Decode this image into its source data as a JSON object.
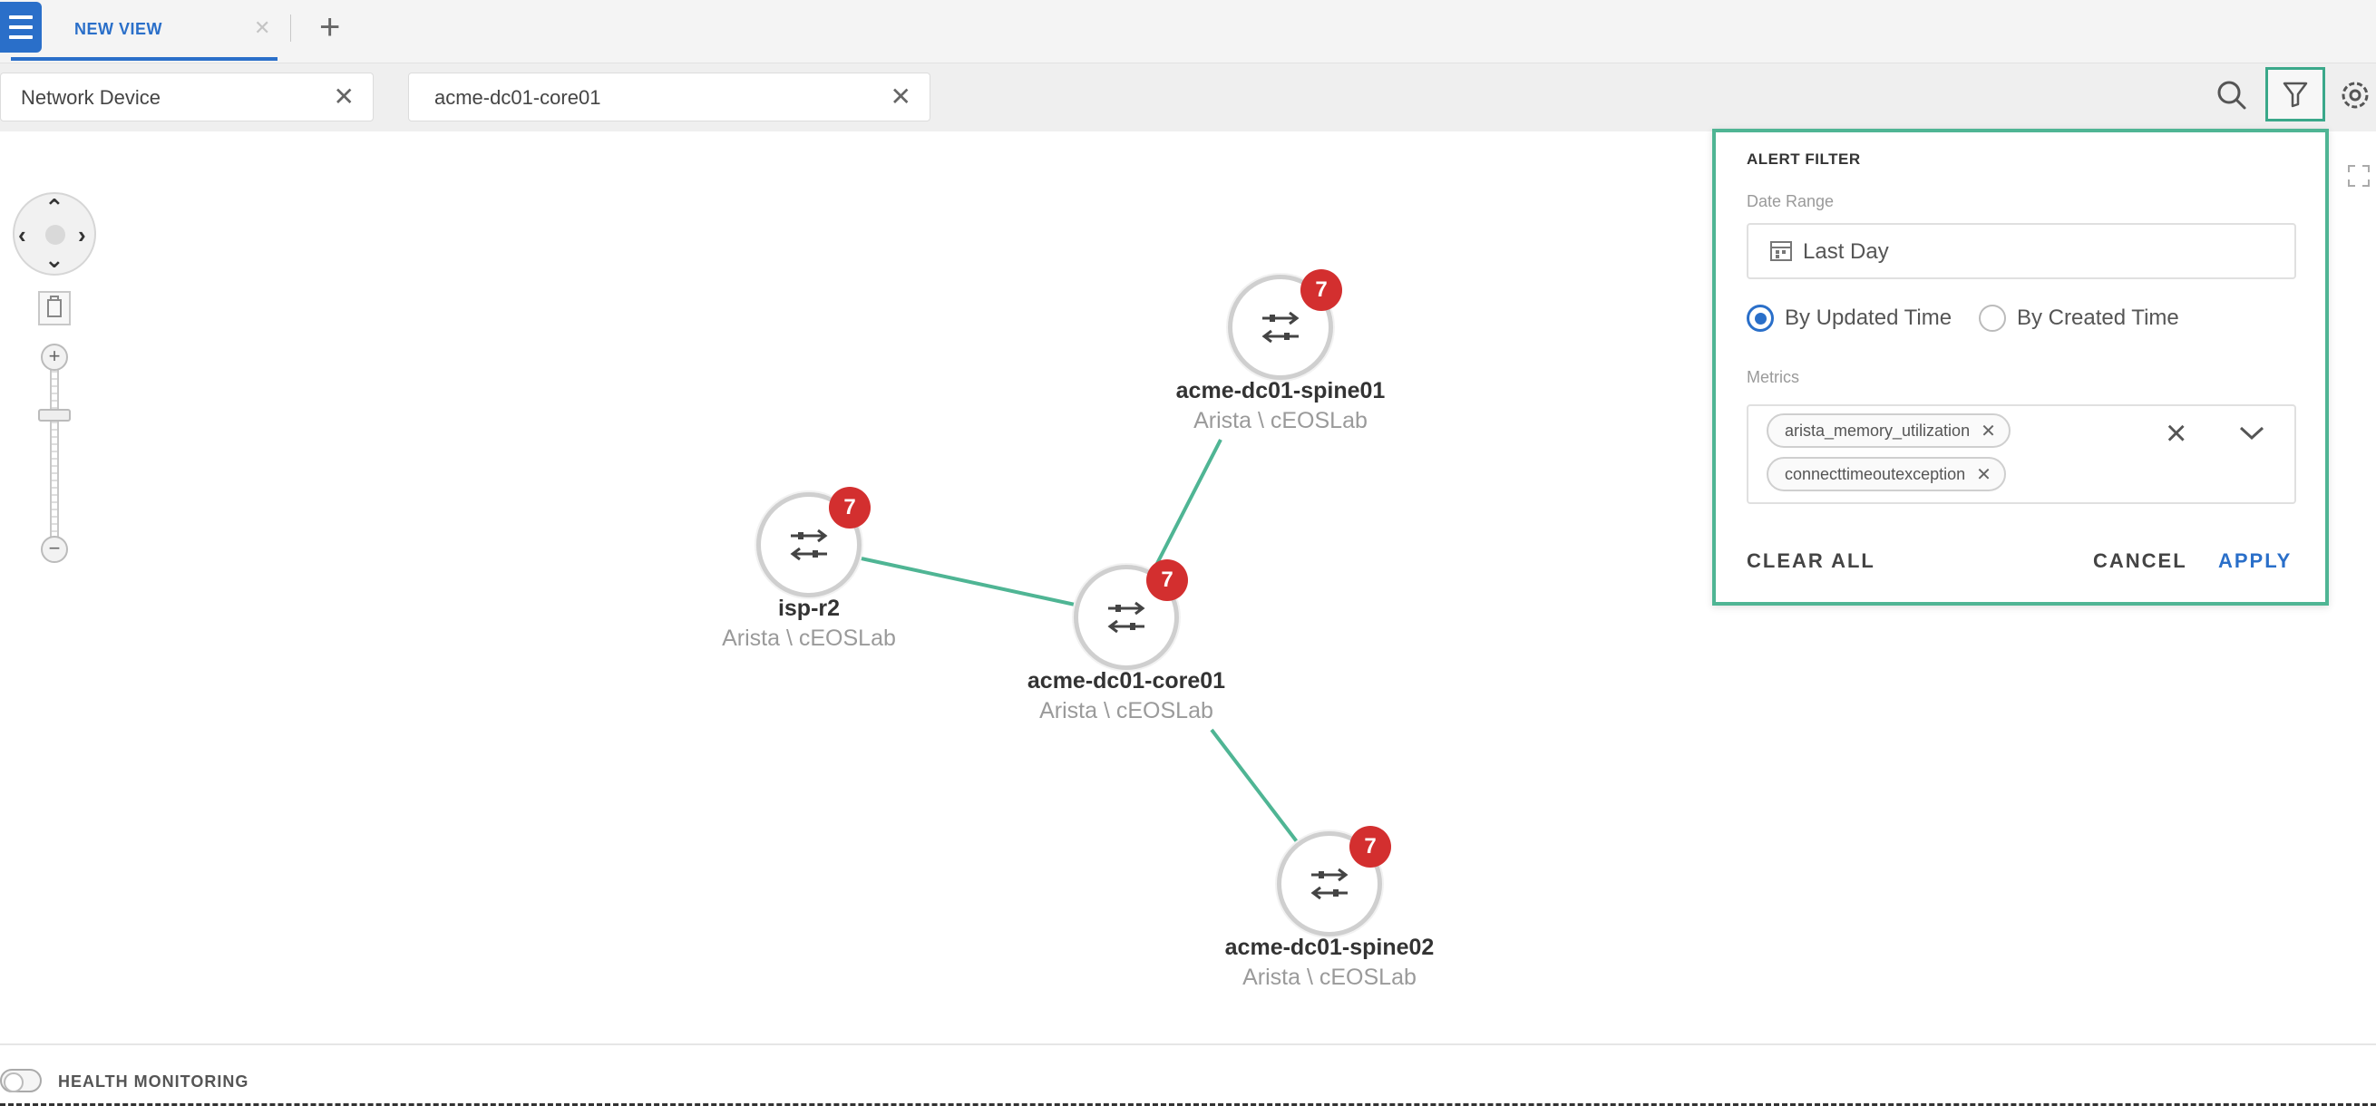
{
  "tabs": {
    "active_label": "NEW VIEW"
  },
  "filter_bar": {
    "chip1_text": "Network Device",
    "chip2_text": "acme-dc01-core01"
  },
  "nodes": {
    "spine01": {
      "name": "acme-dc01-spine01",
      "vendor": "Arista \\ cEOSLab",
      "alerts": "7"
    },
    "isp": {
      "name": "isp-r2",
      "vendor": "Arista \\ cEOSLab",
      "alerts": "7"
    },
    "core": {
      "name": "acme-dc01-core01",
      "vendor": "Arista \\ cEOSLab",
      "alerts": "7"
    },
    "spine02": {
      "name": "acme-dc01-spine02",
      "vendor": "Arista \\ cEOSLab",
      "alerts": "7"
    }
  },
  "alert_filter": {
    "title": "ALERT FILTER",
    "date_range_label": "Date Range",
    "date_range_value": "Last Day",
    "radio_updated": "By Updated Time",
    "radio_created": "By Created Time",
    "selected_radio": "By Updated Time",
    "metrics_label": "Metrics",
    "metrics": [
      "arista_memory_utilization",
      "connecttimeoutexception"
    ],
    "clear_all": "CLEAR ALL",
    "cancel": "CANCEL",
    "apply": "APPLY"
  },
  "bottom": {
    "health_label": "HEALTH MONITORING"
  },
  "colors": {
    "accent": "#2a6fc9",
    "edge": "#4fb594",
    "badge": "#d32f2f"
  },
  "icons": [
    "menu-icon",
    "close-icon",
    "plus-icon",
    "search-icon",
    "filter-icon",
    "settings-icon",
    "calendar-icon",
    "chevron-down-icon",
    "switch-icon",
    "expand-icon"
  ]
}
